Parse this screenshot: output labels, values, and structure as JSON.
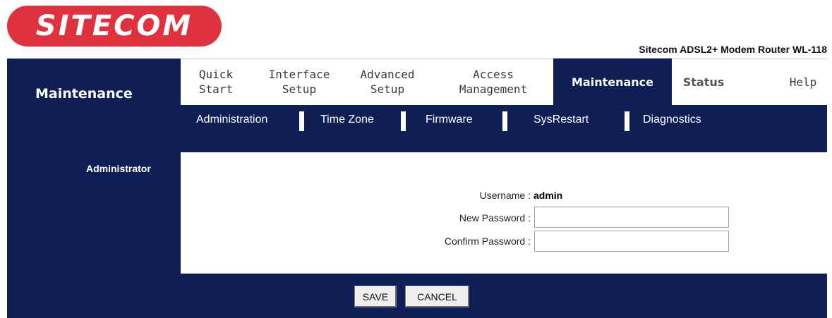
{
  "brand": {
    "logo_text": "SITECOM",
    "logo_color": "#e0313f"
  },
  "model": "Sitecom ADSL2+ Modem Router WL-118",
  "sidebar": {
    "title": "Maintenance",
    "section_label": "Administrator"
  },
  "tabs": [
    {
      "line1": "Quick",
      "line2": "Start"
    },
    {
      "line1": "Interface",
      "line2": "Setup"
    },
    {
      "line1": "Advanced",
      "line2": "Setup"
    },
    {
      "line1": "Access",
      "line2": "Management"
    },
    {
      "line1": "Maintenance",
      "line2": ""
    },
    {
      "line1": "Status",
      "line2": ""
    },
    {
      "line1": "Help",
      "line2": ""
    }
  ],
  "subtabs": [
    "Administration",
    "Time Zone",
    "Firmware",
    "SysRestart",
    "Diagnostics"
  ],
  "form": {
    "username_label": "Username :",
    "username_value": "admin",
    "new_password_label": "New Password :",
    "new_password_value": "",
    "confirm_password_label": "Confirm Password :",
    "confirm_password_value": ""
  },
  "buttons": {
    "save": "SAVE",
    "cancel": "CANCEL"
  },
  "colors": {
    "navy": "#0f1e55",
    "accent": "#e0313f"
  }
}
